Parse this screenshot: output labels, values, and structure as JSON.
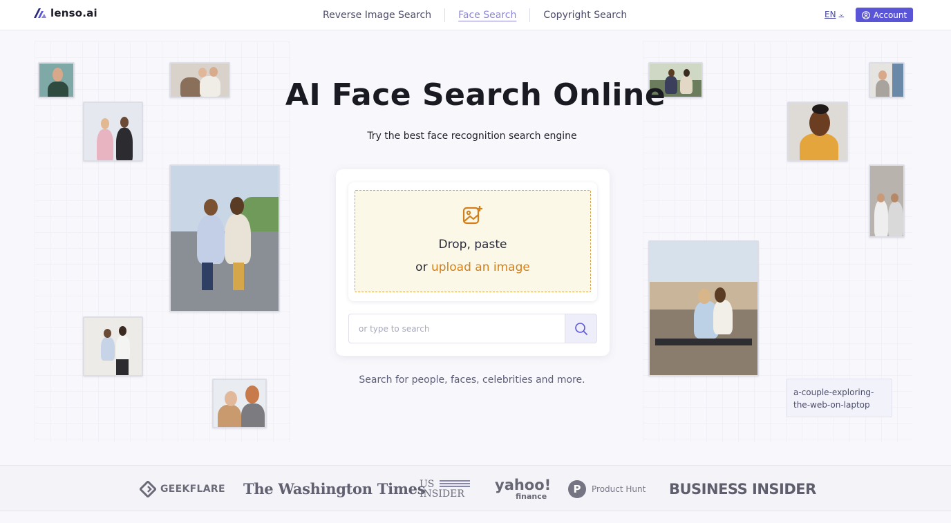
{
  "header": {
    "logo_text": "lenso.ai",
    "nav": [
      {
        "label": "Reverse Image Search",
        "active": false
      },
      {
        "label": "Face Search",
        "active": true
      },
      {
        "label": "Copyright Search",
        "active": false
      }
    ],
    "language": "EN",
    "account_label": "Account"
  },
  "hero": {
    "title": "AI Face Search Online",
    "subtitle": "Try the best face recognition search engine",
    "drop_line1": "Drop, paste",
    "drop_or": "or ",
    "upload_link": "upload an image",
    "search_placeholder": "or type to search",
    "note": "Search for people, faces, celebrities and more."
  },
  "tooltip": "a-couple-exploring-the-web-on-laptop",
  "press": {
    "geekflare": "GEEKFLARE",
    "washington_times": "The Washington Times",
    "us_insider_1": "US",
    "us_insider_2": "INSIDER",
    "yahoo_1": "yahoo!",
    "yahoo_2": "finance",
    "product_hunt": "Product Hunt",
    "product_hunt_letter": "P",
    "business_insider": "BUSINESS INSIDER"
  },
  "colors": {
    "brand": "#5a54d6",
    "accent_orange": "#d2801c",
    "nav_active": "#8b86d8"
  }
}
